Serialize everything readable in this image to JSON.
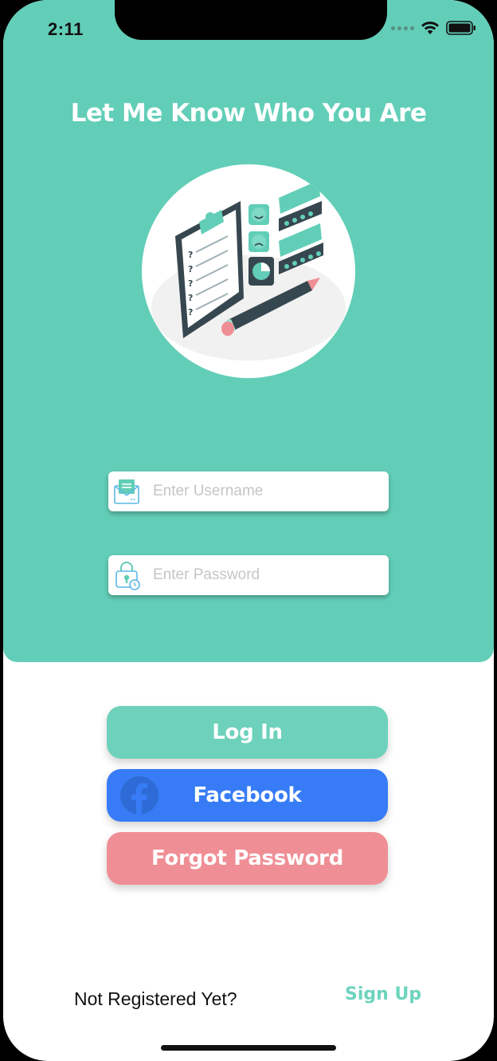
{
  "status_bar": {
    "time": "2:11"
  },
  "header": {
    "title": "Let Me Know Who You Are"
  },
  "form": {
    "username_placeholder": "Enter Username",
    "username_value": "",
    "password_placeholder": "Enter Password",
    "password_value": ""
  },
  "buttons": {
    "login_label": "Log In",
    "facebook_label": "Facebook",
    "forgot_label": "Forgot Password"
  },
  "footer": {
    "prompt_text": "Not Registered Yet?",
    "signup_label": "Sign Up"
  },
  "colors": {
    "hero_bg": "#62ceb7",
    "login_button": "#6dd1bb",
    "facebook_button": "#377cf6",
    "forgot_button": "#ef8f95",
    "signup_link": "#6dd3bd"
  },
  "icons": {
    "username_field": "envelope-icon",
    "password_field": "lock-icon",
    "facebook_button": "facebook-logo-icon",
    "status_signal": "signal-icon",
    "status_wifi": "wifi-icon",
    "status_battery": "battery-icon"
  }
}
